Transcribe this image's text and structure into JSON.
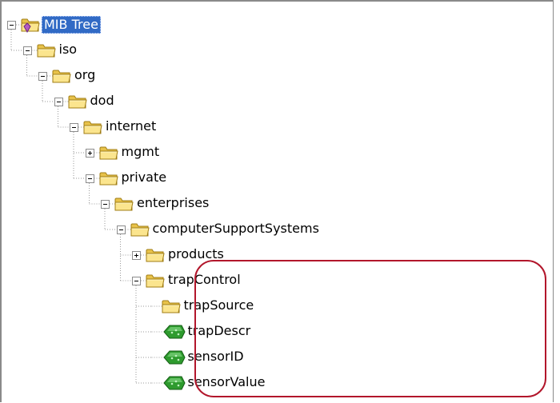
{
  "tree": {
    "root": {
      "label": "MIB Tree",
      "icon": "mib-root-icon",
      "expanded": true,
      "selected": true
    },
    "nodes": [
      {
        "label": "iso",
        "icon": "folder-icon",
        "state": "expanded",
        "depth": 1
      },
      {
        "label": "org",
        "icon": "folder-icon",
        "state": "expanded",
        "depth": 2
      },
      {
        "label": "dod",
        "icon": "folder-icon",
        "state": "expanded",
        "depth": 3
      },
      {
        "label": "internet",
        "icon": "folder-icon",
        "state": "expanded",
        "depth": 4
      },
      {
        "label": "mgmt",
        "icon": "folder-icon",
        "state": "collapsed",
        "depth": 5
      },
      {
        "label": "private",
        "icon": "folder-icon",
        "state": "expanded",
        "depth": 5
      },
      {
        "label": "enterprises",
        "icon": "folder-icon",
        "state": "expanded",
        "depth": 6
      },
      {
        "label": "computerSupportSystems",
        "icon": "folder-icon",
        "state": "expanded",
        "depth": 7
      },
      {
        "label": "products",
        "icon": "folder-icon",
        "state": "collapsed",
        "depth": 8
      },
      {
        "label": "trapControl",
        "icon": "folder-icon",
        "state": "expanded",
        "depth": 8
      },
      {
        "label": "trapSource",
        "icon": "folder-icon",
        "state": "leaf",
        "depth": 9
      },
      {
        "label": "trapDescr",
        "icon": "green-leaf-object-icon",
        "state": "leaf",
        "depth": 9
      },
      {
        "label": "sensorID",
        "icon": "green-leaf-object-icon",
        "state": "leaf",
        "depth": 9
      },
      {
        "label": "sensorValue",
        "icon": "green-leaf-object-icon",
        "state": "leaf",
        "depth": 9
      }
    ]
  },
  "annotation": {
    "color": "#b2162b"
  },
  "colors": {
    "selection": "#316ac5",
    "folder": "#f5d76e",
    "leaf_object": "#2e9b2e"
  }
}
